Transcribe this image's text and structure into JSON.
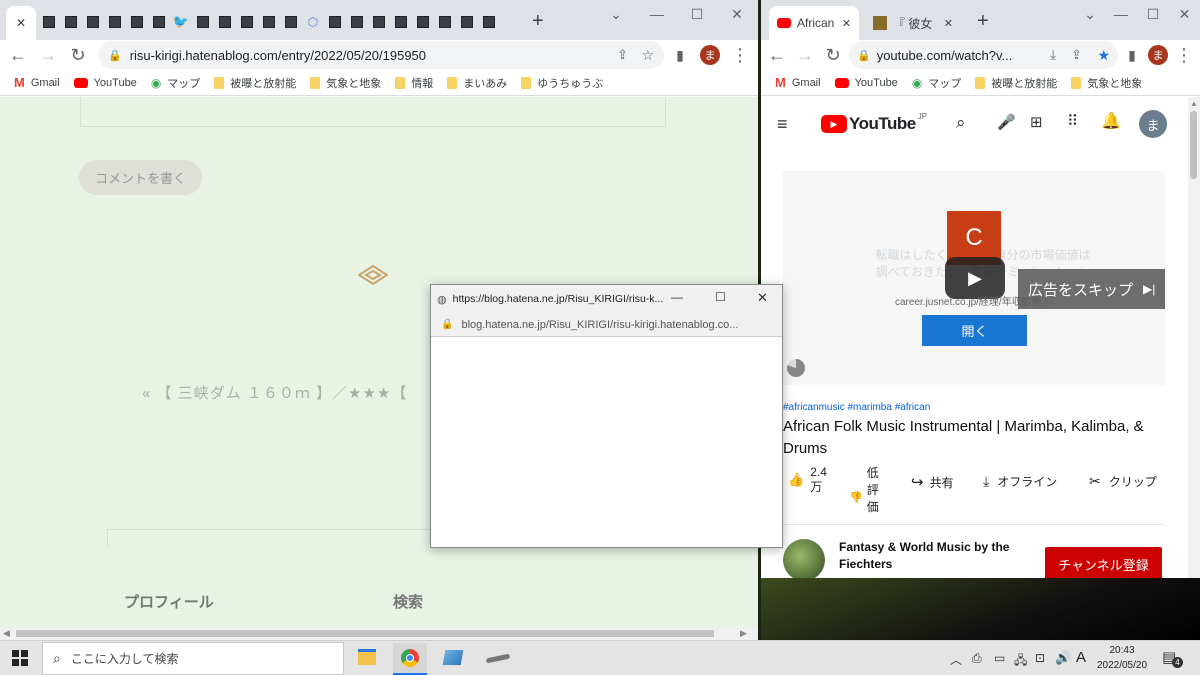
{
  "colors": {
    "tab_bg": "#dee1e6",
    "content_bg": "#e8f3e5",
    "youtube_red": "#ff0000",
    "accent_blue": "#1a73e8",
    "subscribe_red": "#cc0000",
    "ad_button": "#1976d2"
  },
  "left": {
    "active_tab_close": "✕",
    "new_tab": "+",
    "url": "risu-kirigi.hatenablog.com/entry/2022/05/20/195950",
    "bookmarks": [
      "Gmail",
      "YouTube",
      "マップ",
      "被曝と放射能",
      "気象と地象",
      "情報",
      "まいあみ",
      "ゆうちゅうぶ"
    ],
    "profile": "ま",
    "comment_button": "コメントを書く",
    "prev_link": "« 【 三峡ダム １６０ｍ 】／★★★【",
    "sidebar_profile": "プロフィール",
    "sidebar_search": "検索"
  },
  "popup": {
    "title": "https://blog.hatena.ne.jp/Risu_KIRIGI/risu-k...",
    "url": "blog.hatena.ne.jp/Risu_KIRIGI/risu-kirigi.hatenablog.co..."
  },
  "right": {
    "tab1": "African F",
    "tab2": "『 彼女",
    "new_tab": "+",
    "url": "youtube.com/watch?v...",
    "bookmarks": [
      "Gmail",
      "YouTube",
      "マップ",
      "被曝と放射能",
      "気象と地象"
    ],
    "profile": "ま",
    "yt_logo": "YouTube",
    "yt_region": "JP",
    "yt_avatar": "ま",
    "ad_channel_letter": "C",
    "ad_text1": "転職はしたくなくても自分の市場価値は",
    "ad_text2": "調べておきたい。年収シミュレーション",
    "ad_domain": "career.jusnet.co.jp/経理/年収診断",
    "ad_open": "開く",
    "ad_skip": "広告をスキップ",
    "hashtags": "#africanmusic #marimba #african",
    "video_title": "African Folk Music Instrumental | Marimba, Kalimba, & Drums",
    "likes": "2.4万",
    "dislike": "低評価",
    "share": "共有",
    "offline": "オフライン",
    "clip": "クリップ",
    "channel_name": "Fantasy & World Music by the Fiechters",
    "subscribe": "チャンネル登録"
  },
  "taskbar": {
    "search_placeholder": "ここに入力して検索",
    "time": "20:43",
    "date": "2022/05/20",
    "notifications": "4",
    "ime": "A"
  }
}
